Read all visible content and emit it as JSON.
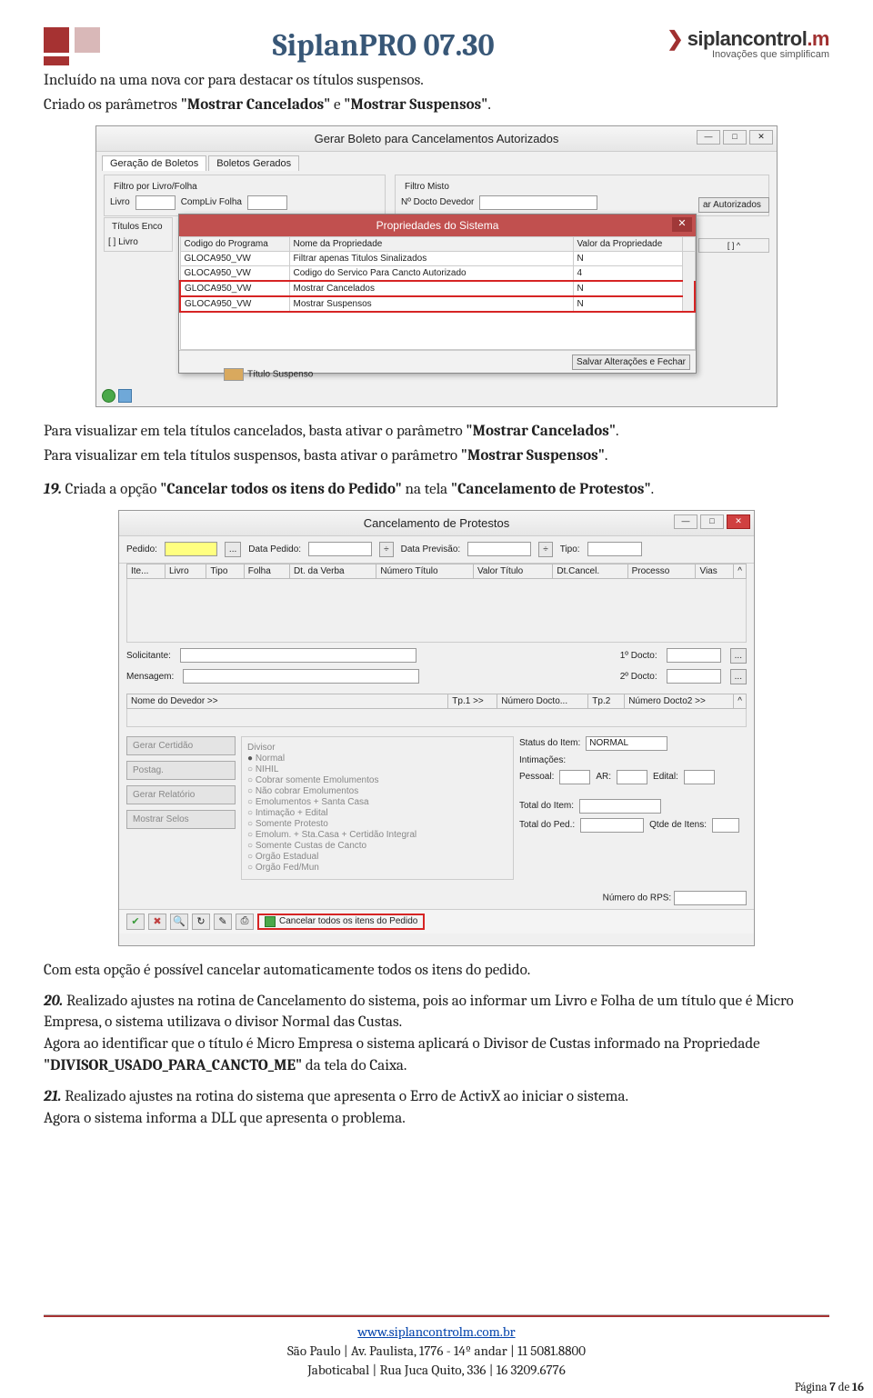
{
  "header": {
    "title": "SiplanPRO 07.30",
    "brand": "siplancontrol",
    "brand_suffix": ".m",
    "tagline": "Inovações que simplificam"
  },
  "intro": {
    "l1": "Incluído na uma nova cor para destacar os títulos suspensos.",
    "l2_a": "Criado os parâmetros ",
    "l2_b": "\"Mostrar Cancelados\"",
    "l2_c": " e ",
    "l2_d": "\"Mostrar Suspensos\"",
    "l2_e": "."
  },
  "ss1": {
    "title": "Gerar Boleto para Cancelamentos Autorizados",
    "tab1": "Geração de Boletos",
    "tab2": "Boletos Gerados",
    "fs1": "Filtro por Livro/Folha",
    "lbl_livro": "Livro",
    "lbl_comp": "CompLiv Folha",
    "fs2": "Filtro Misto",
    "lbl_docto": "Nº Docto Devedor",
    "btn_aut": "ar Autorizados",
    "fs3": "Títulos Enco",
    "row_h": "[ ]  Livro",
    "modal_title": "Propriedades do Sistema",
    "col1": "Codigo do Programa",
    "col2": "Nome da Propriedade",
    "col3": "Valor da Propriedade",
    "rows": [
      {
        "c1": "GLOCA950_VW",
        "c2": "Filtrar apenas Titulos Sinalizados",
        "c3": "N"
      },
      {
        "c1": "GLOCA950_VW",
        "c2": "Codigo do Servico Para Cancto Autorizado",
        "c3": "4"
      },
      {
        "c1": "GLOCA950_VW",
        "c2": "Mostrar Cancelados",
        "c3": "N"
      },
      {
        "c1": "GLOCA950_VW",
        "c2": "Mostrar Suspensos",
        "c3": "N"
      }
    ],
    "save_btn": "Salvar Alterações e Fechar",
    "tit_susp": "Título Suspenso"
  },
  "mid": {
    "p1_a": "Para visualizar em tela títulos cancelados, basta ativar o parâmetro ",
    "p1_b": "\"Mostrar Cancelados\"",
    "p1_c": ".",
    "p2_a": "Para visualizar em tela títulos suspensos, basta ativar o parâmetro ",
    "p2_b": "\"Mostrar Suspensos\"",
    "p2_c": "."
  },
  "item19": {
    "num": "19.",
    "t1": " Criada a opção ",
    "t2": "\"Cancelar todos os itens do Pedido\"",
    "t3": " na tela ",
    "t4": "\"Cancelamento de Protestos\"",
    "t5": "."
  },
  "ss2": {
    "title": "Cancelamento de Protestos",
    "pedido": "Pedido:",
    "datap": "Data Pedido:",
    "dataprev": "Data Previsão:",
    "tipo": "Tipo:",
    "cols": [
      "Ite...",
      "Livro",
      "Tipo",
      "Folha",
      "Dt. da Verba",
      "Número Título",
      "Valor Título",
      "Dt.Cancel.",
      "Processo",
      "Vias"
    ],
    "solic": "Solicitante:",
    "mens": "Mensagem:",
    "d1": "1º Docto:",
    "d2": "2º Docto:",
    "gcols": [
      "Nome do Devedor >>",
      "Tp.1 >>",
      "Número Docto...",
      "Tp.2",
      "Número Docto2 >>"
    ],
    "lbtns": [
      "Gerar Certidão",
      "Postag.",
      "Gerar Relatório",
      "Mostrar Selos"
    ],
    "divisor": "Divisor",
    "radios": [
      "Normal",
      "NIHIL",
      "Cobrar somente Emolumentos",
      "Não cobrar Emolumentos",
      "Emolumentos + Santa Casa",
      "Intimação + Edital",
      "Somente Protesto",
      "Emolum. + Sta.Casa + Certidão Integral",
      "Somente Custas de Cancto",
      "Orgão Estadual",
      "Orgão Fed/Mun"
    ],
    "status_l": "Status do Item:",
    "status_v": "NORMAL",
    "intim": "Intimações:",
    "pess": "Pessoal:",
    "ar": "AR:",
    "edital": "Edital:",
    "toti": "Total do Item:",
    "totp": "Total do Ped.:",
    "qtde": "Qtde de Itens:",
    "nrps": "Número do RPS:",
    "cancel_all": "Cancelar todos os itens do Pedido"
  },
  "post_ss2": "Com esta opção é possível cancelar automaticamente todos os itens do pedido.",
  "item20": {
    "num": "20.",
    "l1": " Realizado ajustes na rotina de Cancelamento do sistema, pois ao informar um Livro e Folha de um título que é Micro Empresa, o sistema utilizava o divisor Normal das Custas.",
    "l2_a": "Agora ao identificar que o título é Micro Empresa o sistema aplicará o Divisor de Custas informado na Propriedade ",
    "l2_b": "\"DIVISOR_USADO_PARA_CANCTO_ME\"",
    "l2_c": " da tela do Caixa."
  },
  "item21": {
    "num": "21.",
    "l1": " Realizado ajustes na rotina do sistema que apresenta o Erro de ActivX ao iniciar o sistema.",
    "l2": "Agora o sistema informa a DLL que apresenta o problema."
  },
  "footer": {
    "url": "www.siplancontrolm.com.br",
    "l1": "São Paulo | Av. Paulista, 1776 - 14º andar | 11 5081.8800",
    "l2": "Jaboticabal | Rua Juca Quito, 336 | 16 3209.6776",
    "page_a": "Página ",
    "page_n": "7",
    "page_b": " de ",
    "page_t": "16"
  }
}
